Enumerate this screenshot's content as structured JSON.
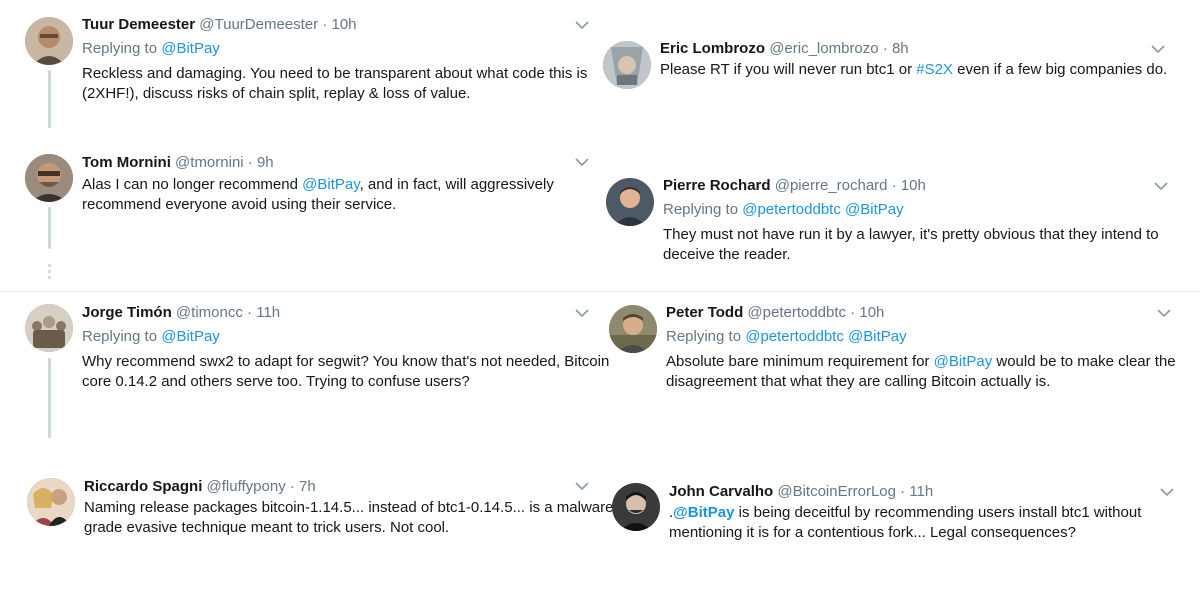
{
  "left": {
    "tweet1": {
      "name": "Tuur Demeester",
      "handle": "@TuurDemeester",
      "dot": "·",
      "time": "10h",
      "replying_prefix": "Replying to",
      "replying_to": "@BitPay",
      "line1": "Reckless and damaging. You need to be transparent about what code this is",
      "line2": "(2XHF!), discuss risks of chain split, replay & loss of value.",
      "avatar_color": "#b88a6a"
    },
    "tweet2": {
      "name": "Tom Mornini",
      "handle": "@tmornini",
      "dot": "·",
      "time": "9h",
      "line1_pre": "Alas I can no longer recommend ",
      "line1_mention": "@BitPay",
      "line1_post": ", and in fact, will aggressively",
      "line2": "recommend everyone avoid using their service.",
      "avatar_color": "#6d5a4c"
    },
    "tweet3": {
      "name": "Jorge Timón",
      "handle": "@timoncc",
      "dot": "·",
      "time": "11h",
      "replying_prefix": "Replying to",
      "replying_to": "@BitPay",
      "line1": "Why recommend swx2 to adapt for segwit? You know that's not needed, Bitcoin",
      "line2": "core 0.14.2 and others serve too. Trying to confuse users?",
      "avatar_color": "#a89a86"
    },
    "tweet4": {
      "name": "Riccardo Spagni",
      "handle": "@fluffypony",
      "dot": "·",
      "time": "7h",
      "line1": "Naming release packages bitcoin-1.14.5... instead of btc1-0.14.5... is a malware-",
      "line2": "grade evasive technique meant to trick users. Not cool.",
      "avatar_color": "#c9a080"
    }
  },
  "right": {
    "tweet1": {
      "name": "Eric Lombrozo",
      "handle": "@eric_lombrozo",
      "dot": "·",
      "time": "8h",
      "line1_pre": "Please RT if you will never run btc1 or ",
      "line1_hashtag": "#S2X",
      "line1_post": " even if a few big companies do.",
      "avatar_color": "#9aa3a8"
    },
    "tweet2": {
      "name": "Pierre Rochard",
      "handle": "@pierre_rochard",
      "dot": "·",
      "time": "10h",
      "replying_prefix": "Replying to",
      "replying_to_1": "@petertoddbtc",
      "replying_to_2": "@BitPay",
      "line1": "They must not have run it by a lawyer, it's pretty obvious that they intend to",
      "line2": "deceive the reader.",
      "avatar_color": "#3f4a56"
    },
    "tweet3": {
      "name": "Peter Todd",
      "handle": "@petertoddbtc",
      "dot": "·",
      "time": "10h",
      "replying_prefix": "Replying to",
      "replying_to_1": "@petertoddbtc",
      "replying_to_2": "@BitPay",
      "line1_pre": "Absolute bare minimum requirement for ",
      "line1_mention": "@BitPay",
      "line1_post": " would be to make clear the",
      "line2": "disagreement that what they are calling Bitcoin actually is.",
      "avatar_color": "#7d7a5a"
    },
    "tweet4": {
      "name": "John Carvalho",
      "handle": "@BitcoinErrorLog",
      "dot": "·",
      "time": "11h",
      "line1_pre": ".",
      "line1_mention": "@BitPay",
      "line1_post": " is being deceitful by recommending users install btc1 without",
      "line2": "mentioning it is for a contentious fork... Legal consequences?",
      "avatar_color": "#2a2a2a"
    }
  },
  "icons": {
    "chevron": "chevron-down-icon"
  },
  "colors": {
    "link": "#1b95e0",
    "secondary": "#657786",
    "thread_line": "#ccd6dd"
  }
}
